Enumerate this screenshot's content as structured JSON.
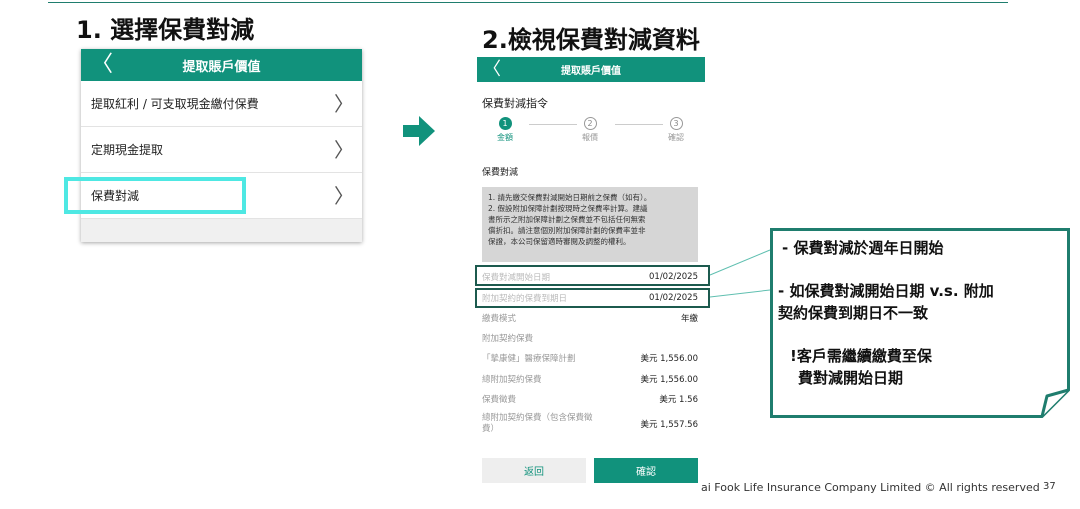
{
  "step1": {
    "heading": "1. 選擇保費對減",
    "bar_title": "提取賬戶價值",
    "back_glyph": "〈",
    "items": [
      {
        "label": "提取紅利 / 可支取現金繳付保費"
      },
      {
        "label": "定期現金提取"
      },
      {
        "label": "保費對減"
      }
    ],
    "chevron_glyph": "〉"
  },
  "step2": {
    "heading": "2.檢視保費對減資料",
    "bar_title": "提取賬戶價值",
    "subtitle": "保費對減指令",
    "steps": [
      {
        "num": "1",
        "label": "金額"
      },
      {
        "num": "2",
        "label": "報價"
      },
      {
        "num": "3",
        "label": "確認"
      }
    ],
    "section_label": "保費對減",
    "notice_lines": [
      "1. 請先繳交保費對減開始日期前之保費（如有）。",
      "2. 假設附加保障計劃按現時之保費率計算。建議",
      "書所示之附加保障計劃之保費並不包括任何無索",
      "償折扣。請注意個別附加保障計劃的保費率並非",
      "保證，本公司保留適時審閱及調整的權利。"
    ],
    "rows": [
      {
        "key": "保費對減開始日期",
        "value": "01/02/2025"
      },
      {
        "key": "附加契約的保費到期日",
        "value": "01/02/2025"
      },
      {
        "key": "繳費模式",
        "value": "年繳"
      },
      {
        "key": "附加契約保費",
        "value": ""
      },
      {
        "key": "「摯康健」醫療保障計劃",
        "value": "美元 1,556.00"
      },
      {
        "key": "總附加契約保費",
        "value": "美元 1,556.00"
      },
      {
        "key": "保費徵費",
        "value": "美元 1.56"
      },
      {
        "key": "總附加契約保費（包含保費徵",
        "key2": "費）",
        "value": "美元 1,557.56"
      }
    ],
    "back_button": "返回",
    "confirm_button": "確認"
  },
  "callout": {
    "line1": "- 保費對減於週年日開始",
    "line2a": "- 如保費對減開始日期 v.s. 附加",
    "line2b": "契約保費到期日不一致",
    "line3a": "!客戶需繼續繳費至保",
    "line3b": "費對減開始日期"
  },
  "footer": {
    "text": "ai Fook Life Insurance Company Limited © All rights reserved",
    "page": "37"
  },
  "colors": {
    "brand_teal": "#11927c",
    "highlight_cyan": "#4ee8e3",
    "box_dark_teal": "#1c5a4e",
    "callout_border": "#1f7d6e"
  }
}
